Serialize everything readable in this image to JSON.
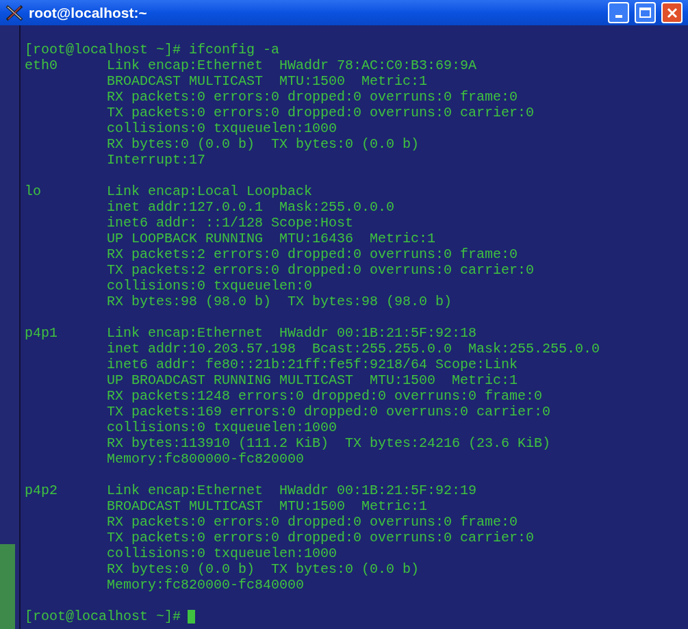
{
  "window": {
    "title": "root@localhost:~"
  },
  "terminal": {
    "command_line": "[root@localhost ~]# ifconfig -a",
    "interfaces": [
      {
        "name": "eth0",
        "lines": [
          "Link encap:Ethernet  HWaddr 78:AC:C0:B3:69:9A",
          "BROADCAST MULTICAST  MTU:1500  Metric:1",
          "RX packets:0 errors:0 dropped:0 overruns:0 frame:0",
          "TX packets:0 errors:0 dropped:0 overruns:0 carrier:0",
          "collisions:0 txqueuelen:1000",
          "RX bytes:0 (0.0 b)  TX bytes:0 (0.0 b)",
          "Interrupt:17"
        ]
      },
      {
        "name": "lo",
        "lines": [
          "Link encap:Local Loopback",
          "inet addr:127.0.0.1  Mask:255.0.0.0",
          "inet6 addr: ::1/128 Scope:Host",
          "UP LOOPBACK RUNNING  MTU:16436  Metric:1",
          "RX packets:2 errors:0 dropped:0 overruns:0 frame:0",
          "TX packets:2 errors:0 dropped:0 overruns:0 carrier:0",
          "collisions:0 txqueuelen:0",
          "RX bytes:98 (98.0 b)  TX bytes:98 (98.0 b)"
        ]
      },
      {
        "name": "p4p1",
        "lines": [
          "Link encap:Ethernet  HWaddr 00:1B:21:5F:92:18",
          "inet addr:10.203.57.198  Bcast:255.255.0.0  Mask:255.255.0.0",
          "inet6 addr: fe80::21b:21ff:fe5f:9218/64 Scope:Link",
          "UP BROADCAST RUNNING MULTICAST  MTU:1500  Metric:1",
          "RX packets:1248 errors:0 dropped:0 overruns:0 frame:0",
          "TX packets:169 errors:0 dropped:0 overruns:0 carrier:0",
          "collisions:0 txqueuelen:1000",
          "RX bytes:113910 (111.2 KiB)  TX bytes:24216 (23.6 KiB)",
          "Memory:fc800000-fc820000"
        ]
      },
      {
        "name": "p4p2",
        "lines": [
          "Link encap:Ethernet  HWaddr 00:1B:21:5F:92:19",
          "BROADCAST MULTICAST  MTU:1500  Metric:1",
          "RX packets:0 errors:0 dropped:0 overruns:0 frame:0",
          "TX packets:0 errors:0 dropped:0 overruns:0 carrier:0",
          "collisions:0 txqueuelen:1000",
          "RX bytes:0 (0.0 b)  TX bytes:0 (0.0 b)",
          "Memory:fc820000-fc840000"
        ]
      }
    ],
    "final_prompt": "[root@localhost ~]#",
    "cursor_visible": true
  }
}
